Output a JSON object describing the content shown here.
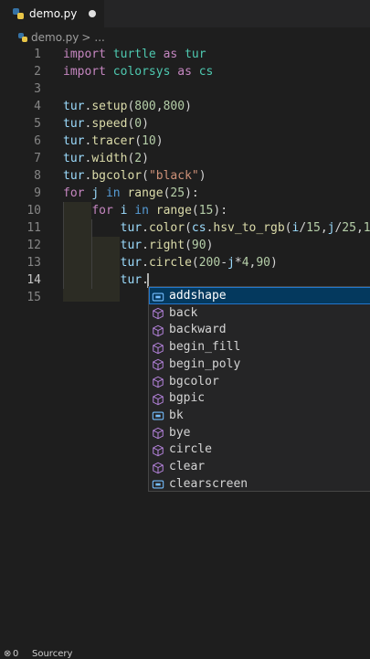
{
  "tab": {
    "filename": "demo.py",
    "icon": "python-file-icon"
  },
  "breadcrumb": {
    "file": "demo.py",
    "separator": ">",
    "more": "..."
  },
  "editor": {
    "active_line": 14,
    "line_numbers": [
      "1",
      "2",
      "3",
      "4",
      "5",
      "6",
      "7",
      "8",
      "9",
      "10",
      "11",
      "12",
      "13",
      "14",
      "15"
    ],
    "lines": [
      [
        [
          "kw",
          "import"
        ],
        [
          "pun",
          " "
        ],
        [
          "mod",
          "turtle"
        ],
        [
          "pun",
          " "
        ],
        [
          "kw",
          "as"
        ],
        [
          "pun",
          " "
        ],
        [
          "mod",
          "tur"
        ]
      ],
      [
        [
          "kw",
          "import"
        ],
        [
          "pun",
          " "
        ],
        [
          "mod",
          "colorsys"
        ],
        [
          "pun",
          " "
        ],
        [
          "kw",
          "as"
        ],
        [
          "pun",
          " "
        ],
        [
          "mod",
          "cs"
        ]
      ],
      [],
      [
        [
          "var",
          "tur"
        ],
        [
          "pun",
          "."
        ],
        [
          "fn",
          "setup"
        ],
        [
          "pun",
          "("
        ],
        [
          "num",
          "800"
        ],
        [
          "pun",
          ","
        ],
        [
          "num",
          "800"
        ],
        [
          "pun",
          ")"
        ]
      ],
      [
        [
          "var",
          "tur"
        ],
        [
          "pun",
          "."
        ],
        [
          "fn",
          "speed"
        ],
        [
          "pun",
          "("
        ],
        [
          "num",
          "0"
        ],
        [
          "pun",
          ")"
        ]
      ],
      [
        [
          "var",
          "tur"
        ],
        [
          "pun",
          "."
        ],
        [
          "fn",
          "tracer"
        ],
        [
          "pun",
          "("
        ],
        [
          "num",
          "10"
        ],
        [
          "pun",
          ")"
        ]
      ],
      [
        [
          "var",
          "tur"
        ],
        [
          "pun",
          "."
        ],
        [
          "fn",
          "width"
        ],
        [
          "pun",
          "("
        ],
        [
          "num",
          "2"
        ],
        [
          "pun",
          ")"
        ]
      ],
      [
        [
          "var",
          "tur"
        ],
        [
          "pun",
          "."
        ],
        [
          "fn",
          "bgcolor"
        ],
        [
          "pun",
          "("
        ],
        [
          "str",
          "\"black\""
        ],
        [
          "pun",
          ")"
        ]
      ],
      [
        [
          "kw",
          "for"
        ],
        [
          "pun",
          " "
        ],
        [
          "var",
          "j"
        ],
        [
          "pun",
          " "
        ],
        [
          "kw2",
          "in"
        ],
        [
          "pun",
          " "
        ],
        [
          "fn",
          "range"
        ],
        [
          "pun",
          "("
        ],
        [
          "num",
          "25"
        ],
        [
          "pun",
          "):"
        ]
      ],
      [
        [
          "pun",
          "    "
        ],
        [
          "kw",
          "for"
        ],
        [
          "pun",
          " "
        ],
        [
          "var",
          "i"
        ],
        [
          "pun",
          " "
        ],
        [
          "kw2",
          "in"
        ],
        [
          "pun",
          " "
        ],
        [
          "fn",
          "range"
        ],
        [
          "pun",
          "("
        ],
        [
          "num",
          "15"
        ],
        [
          "pun",
          "):"
        ]
      ],
      [
        [
          "pun",
          "        "
        ],
        [
          "var",
          "tur"
        ],
        [
          "pun",
          "."
        ],
        [
          "fn",
          "color"
        ],
        [
          "pun",
          "("
        ],
        [
          "var",
          "cs"
        ],
        [
          "pun",
          "."
        ],
        [
          "fn",
          "hsv_to_rgb"
        ],
        [
          "pun",
          "("
        ],
        [
          "var",
          "i"
        ],
        [
          "pun",
          "/"
        ],
        [
          "num",
          "15"
        ],
        [
          "pun",
          ","
        ],
        [
          "var",
          "j"
        ],
        [
          "pun",
          "/"
        ],
        [
          "num",
          "25"
        ],
        [
          "pun",
          ","
        ],
        [
          "num",
          "1"
        ],
        [
          "pun",
          ")"
        ]
      ],
      [
        [
          "pun",
          "        "
        ],
        [
          "var",
          "tur"
        ],
        [
          "pun",
          "."
        ],
        [
          "fn",
          "right"
        ],
        [
          "pun",
          "("
        ],
        [
          "num",
          "90"
        ],
        [
          "pun",
          ")"
        ]
      ],
      [
        [
          "pun",
          "        "
        ],
        [
          "var",
          "tur"
        ],
        [
          "pun",
          "."
        ],
        [
          "fn",
          "circle"
        ],
        [
          "pun",
          "("
        ],
        [
          "num",
          "200"
        ],
        [
          "pun",
          "-"
        ],
        [
          "var",
          "j"
        ],
        [
          "pun",
          "*"
        ],
        [
          "num",
          "4"
        ],
        [
          "pun",
          ","
        ],
        [
          "num",
          "90"
        ],
        [
          "pun",
          ")"
        ]
      ],
      [
        [
          "pun",
          "        "
        ],
        [
          "var",
          "tur"
        ],
        [
          "pun",
          "."
        ]
      ],
      []
    ]
  },
  "suggestions": {
    "selected_index": 0,
    "items": [
      {
        "label": "addshape",
        "kind": "variable",
        "icon": "variable-icon"
      },
      {
        "label": "back",
        "kind": "method",
        "icon": "method-cube-icon"
      },
      {
        "label": "backward",
        "kind": "method",
        "icon": "method-cube-icon"
      },
      {
        "label": "begin_fill",
        "kind": "method",
        "icon": "method-cube-icon"
      },
      {
        "label": "begin_poly",
        "kind": "method",
        "icon": "method-cube-icon"
      },
      {
        "label": "bgcolor",
        "kind": "method",
        "icon": "method-cube-icon"
      },
      {
        "label": "bgpic",
        "kind": "method",
        "icon": "method-cube-icon"
      },
      {
        "label": "bk",
        "kind": "variable",
        "icon": "variable-icon"
      },
      {
        "label": "bye",
        "kind": "method",
        "icon": "method-cube-icon"
      },
      {
        "label": "circle",
        "kind": "method",
        "icon": "method-cube-icon"
      },
      {
        "label": "clear",
        "kind": "method",
        "icon": "method-cube-icon"
      },
      {
        "label": "clearscreen",
        "kind": "variable",
        "icon": "variable-icon"
      }
    ]
  },
  "status": {
    "problems_count": "0",
    "sourcery": "Sourcery"
  },
  "colors": {
    "accent": "#04395e",
    "selection_border": "#2277cc",
    "method_icon": "#b180d7",
    "variable_icon": "#75beff"
  }
}
